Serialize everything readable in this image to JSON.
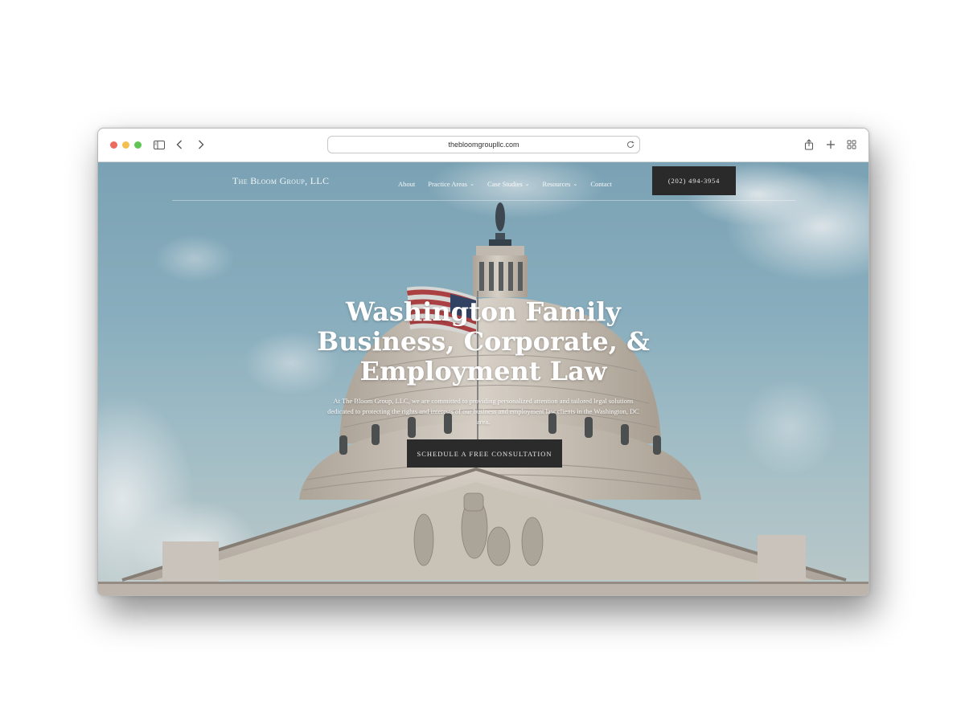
{
  "browser": {
    "url": "thebloomgroupllc.com",
    "traffic_light_colors": [
      "#ed6a5e",
      "#f5bf4f",
      "#61c554"
    ],
    "icons": [
      "sidebar-icon",
      "back-icon",
      "forward-icon",
      "reload-icon",
      "share-icon",
      "new-tab-icon",
      "tab-overview-icon"
    ]
  },
  "site": {
    "logo": {
      "prefix": "The",
      "name": "Bloom Group",
      "suffix": ", LLC"
    },
    "nav": {
      "items": [
        {
          "label": "About",
          "has_dropdown": false
        },
        {
          "label": "Practice Areas",
          "has_dropdown": true
        },
        {
          "label": "Case Studies",
          "has_dropdown": true
        },
        {
          "label": "Resources",
          "has_dropdown": true
        },
        {
          "label": "Contact",
          "has_dropdown": false
        }
      ],
      "phone": "(202) 494-3954"
    },
    "hero": {
      "title_line1": "Washington Family",
      "title_line2": "Business, Corporate, &",
      "title_line3": "Employment Law",
      "subtitle": "At The Bloom Group, LLC, we are committed to providing personalized attention and tailored legal solutions dedicated to protecting the rights and interests of our business and employment law clients in the Washington, DC area.",
      "cta": "SCHEDULE A FREE CONSULTATION"
    },
    "colors": {
      "button_bg": "#2a2a2a",
      "sky": "#8fb6c6"
    }
  }
}
